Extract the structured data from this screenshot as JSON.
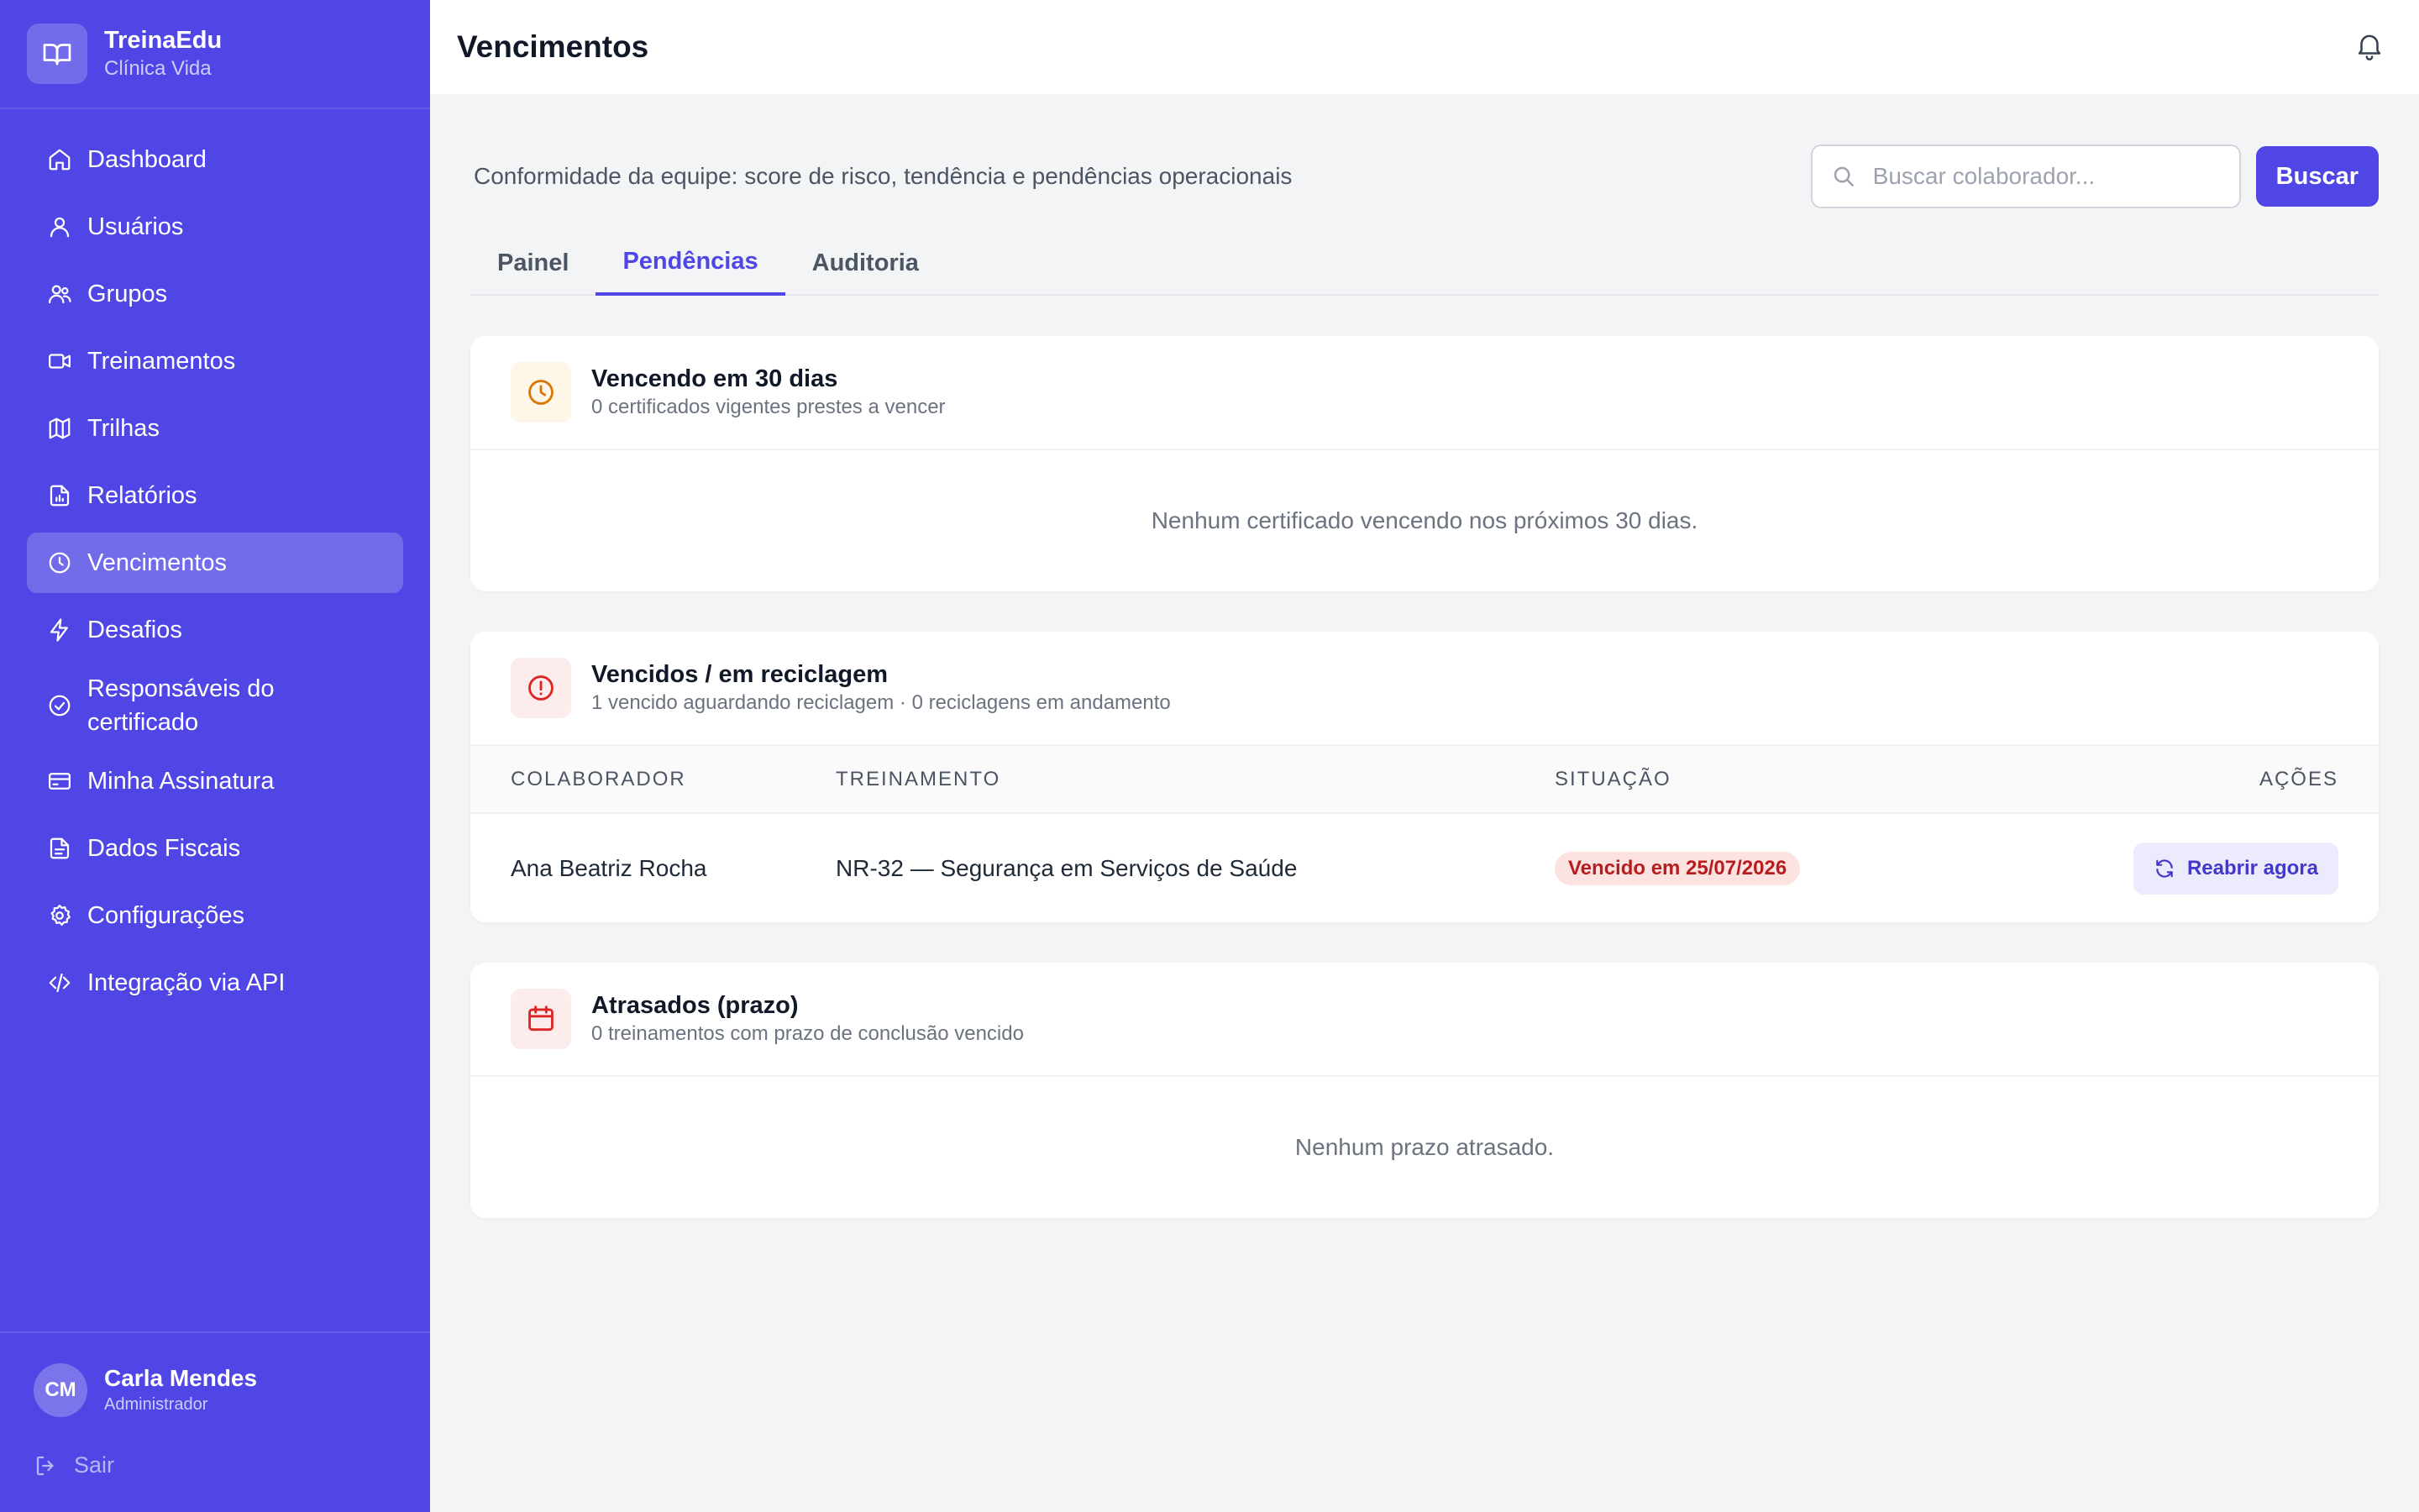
{
  "brand": {
    "name": "TreinaEdu",
    "subtitle": "Clínica Vida"
  },
  "sidebar": {
    "items": [
      {
        "label": "Dashboard",
        "icon": "home-icon"
      },
      {
        "label": "Usuários",
        "icon": "user-icon"
      },
      {
        "label": "Grupos",
        "icon": "users-icon"
      },
      {
        "label": "Treinamentos",
        "icon": "video-icon"
      },
      {
        "label": "Trilhas",
        "icon": "map-icon"
      },
      {
        "label": "Relatórios",
        "icon": "report-icon"
      },
      {
        "label": "Vencimentos",
        "icon": "clock-icon",
        "active": true
      },
      {
        "label": "Desafios",
        "icon": "zap-icon"
      },
      {
        "label": "Responsáveis do certificado",
        "icon": "check-circle-icon"
      },
      {
        "label": "Minha Assinatura",
        "icon": "credit-card-icon"
      },
      {
        "label": "Dados Fiscais",
        "icon": "file-icon"
      },
      {
        "label": "Configurações",
        "icon": "gear-icon"
      },
      {
        "label": "Integração via API",
        "icon": "code-icon"
      }
    ]
  },
  "user": {
    "initials": "CM",
    "name": "Carla Mendes",
    "role": "Administrador",
    "logout_label": "Sair"
  },
  "header": {
    "title": "Vencimentos"
  },
  "main": {
    "subtitle": "Conformidade da equipe: score de risco, tendência e pendências operacionais",
    "search": {
      "placeholder": "Buscar colaborador...",
      "value": "",
      "button_label": "Buscar"
    },
    "tabs": [
      {
        "label": "Painel"
      },
      {
        "label": "Pendências",
        "active": true
      },
      {
        "label": "Auditoria"
      }
    ]
  },
  "cards": {
    "expiring": {
      "title": "Vencendo em 30 dias",
      "description": "0 certificados vigentes prestes a vencer",
      "empty": "Nenhum certificado vencendo nos próximos 30 dias."
    },
    "expired": {
      "title": "Vencidos / em reciclagem",
      "description": "1 vencido aguardando reciclagem · 0 reciclagens em andamento",
      "columns": [
        "COLABORADOR",
        "TREINAMENTO",
        "SITUAÇÃO",
        "AÇÕES"
      ],
      "rows": [
        {
          "employee": "Ana Beatriz Rocha",
          "training": "NR-32 — Segurança em Serviços de Saúde",
          "status": "Vencido em 25/07/2026",
          "action": "Reabrir agora"
        }
      ]
    },
    "overdue": {
      "title": "Atrasados (prazo)",
      "description": "0 treinamentos com prazo de conclusão vencido",
      "empty": "Nenhum prazo atrasado."
    }
  },
  "colors": {
    "primary": "#4f46e5",
    "sidebar_bg": "#4f46e5",
    "page_bg": "#f3f4f6",
    "amber": "#d97706",
    "red": "#dc2626",
    "badge_bg": "#fde2e2",
    "badge_text": "#b91c1c"
  }
}
